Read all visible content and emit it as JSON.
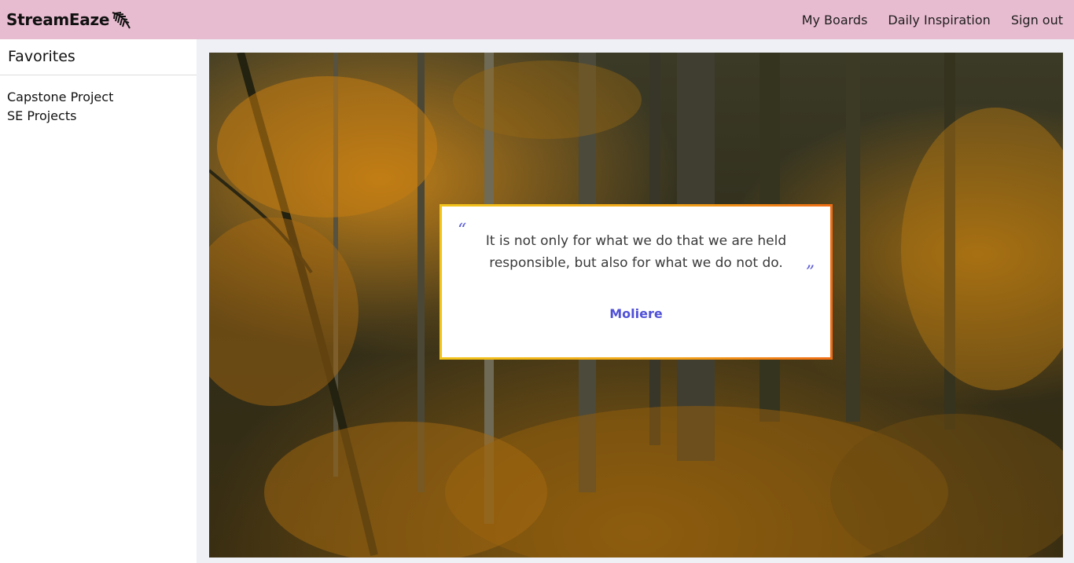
{
  "header": {
    "brand": "StreamEaze",
    "brand_logo_icon": "feather-icon",
    "nav": {
      "my_boards": "My Boards",
      "daily_inspiration": "Daily Inspiration",
      "sign_out": "Sign out"
    },
    "background_color": "#e8bcd0"
  },
  "sidebar": {
    "title": "Favorites",
    "items": [
      {
        "label": "Capstone Project"
      },
      {
        "label": "SE Projects"
      }
    ]
  },
  "main": {
    "background_image": "autumn-forest-photo",
    "quote": {
      "open_mark": "“",
      "close_mark": "”",
      "text": "It is not only for what we do that we are held responsible, but also for what we do not do.",
      "author": "Moliere",
      "accent_color": "#5050d8",
      "border_colors": [
        "#f2c41a",
        "#ef6d14"
      ]
    }
  }
}
